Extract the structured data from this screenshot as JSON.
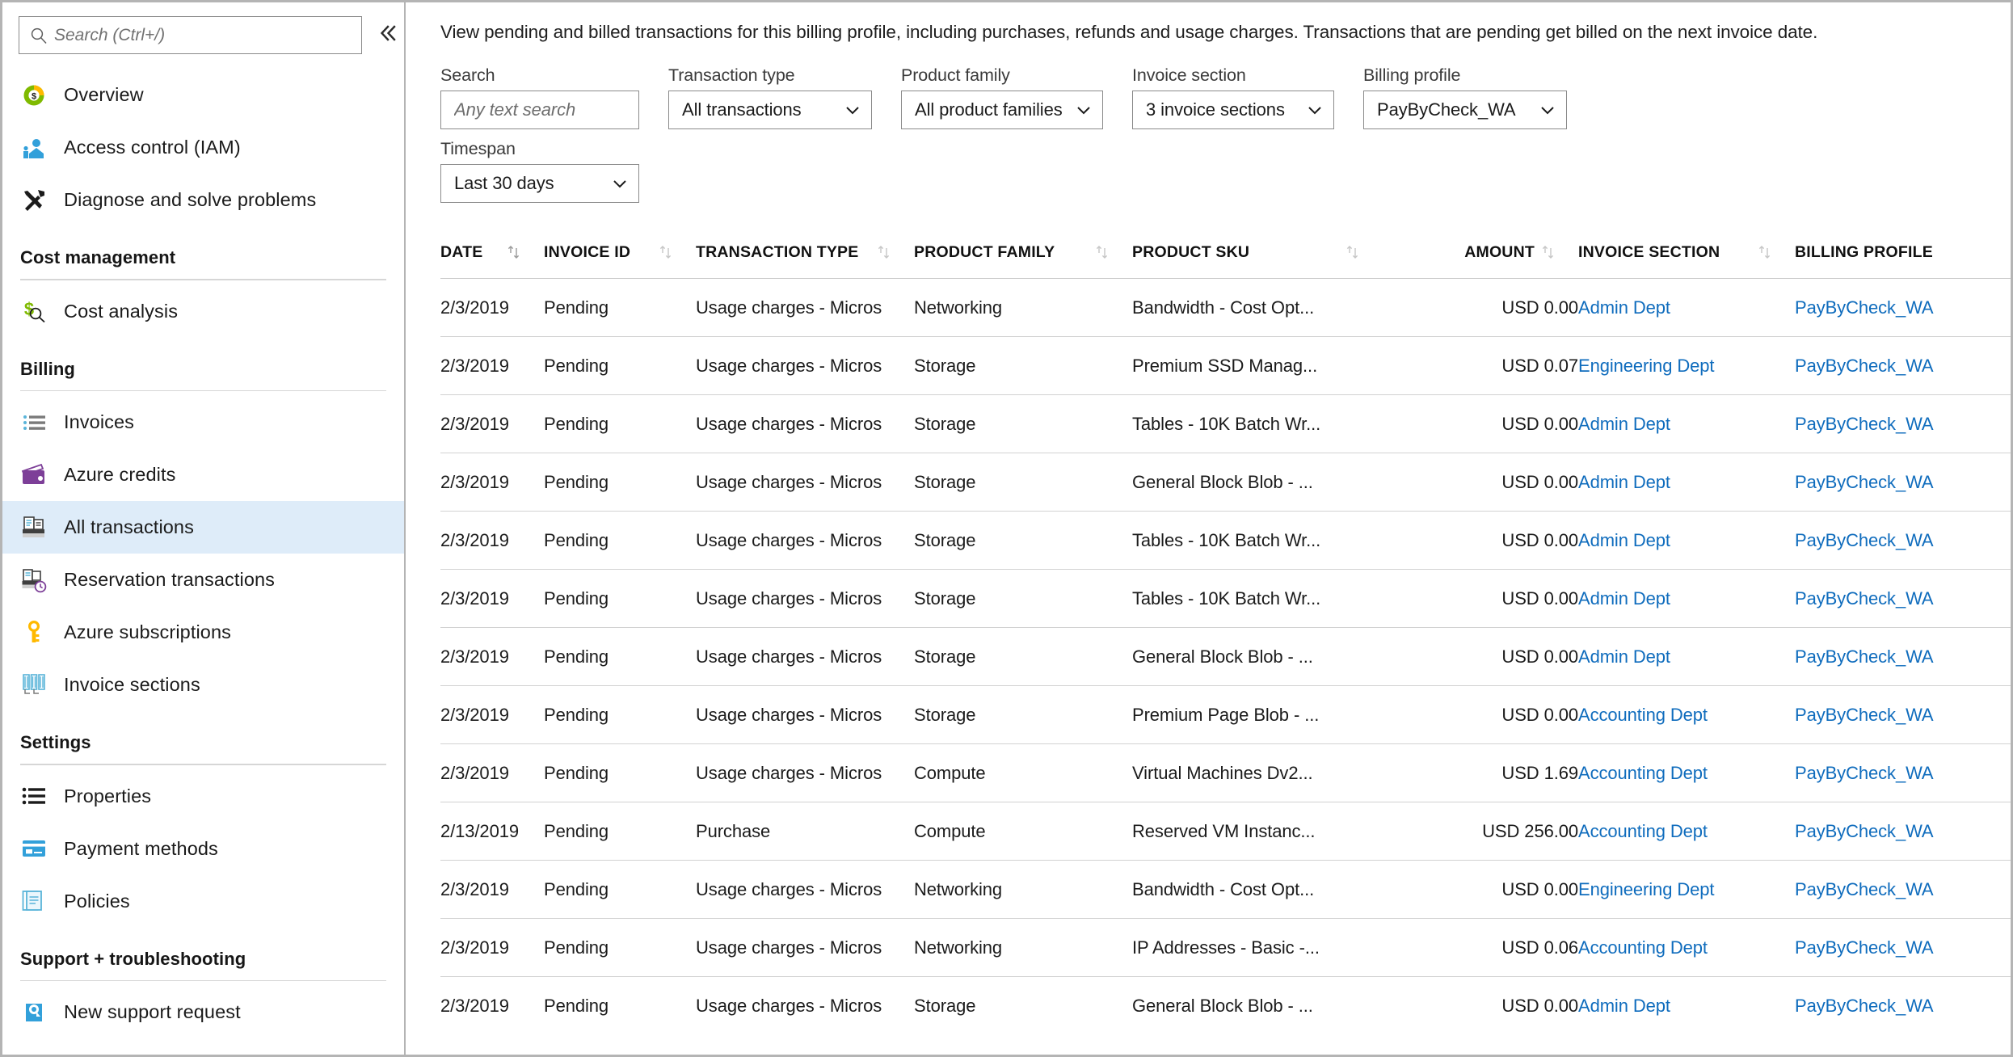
{
  "sidebar": {
    "search": {
      "placeholder": "Search (Ctrl+/)",
      "value": ""
    },
    "collapse_label": "«",
    "top_items": [
      {
        "label": "Overview",
        "icon": "overview-icon"
      },
      {
        "label": "Access control (IAM)",
        "icon": "access-control-icon"
      },
      {
        "label": "Diagnose and solve problems",
        "icon": "diagnose-icon"
      }
    ],
    "groups": [
      {
        "title": "Cost management",
        "items": [
          {
            "label": "Cost analysis",
            "icon": "cost-analysis-icon"
          }
        ]
      },
      {
        "title": "Billing",
        "items": [
          {
            "label": "Invoices",
            "icon": "invoices-icon"
          },
          {
            "label": "Azure credits",
            "icon": "azure-credits-icon"
          },
          {
            "label": "All transactions",
            "icon": "all-transactions-icon",
            "selected": true
          },
          {
            "label": "Reservation transactions",
            "icon": "reservation-transactions-icon"
          },
          {
            "label": "Azure subscriptions",
            "icon": "azure-subscriptions-icon"
          },
          {
            "label": "Invoice sections",
            "icon": "invoice-sections-icon"
          }
        ]
      },
      {
        "title": "Settings",
        "items": [
          {
            "label": "Properties",
            "icon": "properties-icon"
          },
          {
            "label": "Payment methods",
            "icon": "payment-methods-icon"
          },
          {
            "label": "Policies",
            "icon": "policies-icon"
          }
        ]
      },
      {
        "title": "Support + troubleshooting",
        "items": [
          {
            "label": "New support request",
            "icon": "support-request-icon"
          }
        ]
      }
    ]
  },
  "main": {
    "description": "View pending and billed transactions for this billing profile, including purchases, refunds and usage charges. Transactions that are pending get billed on the next invoice date.",
    "filters": [
      {
        "label": "Search",
        "type": "text",
        "value": "",
        "placeholder": "Any text search",
        "name": "search"
      },
      {
        "label": "Transaction type",
        "type": "select",
        "value": "All transactions",
        "name": "transaction-type"
      },
      {
        "label": "Product family",
        "type": "select",
        "value": "All product families",
        "name": "product-family"
      },
      {
        "label": "Invoice section",
        "type": "select",
        "value": "3 invoice sections",
        "name": "invoice-section"
      },
      {
        "label": "Billing profile",
        "type": "select",
        "value": "PayByCheck_WA",
        "name": "billing-profile"
      },
      {
        "label": "Timespan",
        "type": "select",
        "value": "Last 30 days",
        "name": "timespan"
      }
    ],
    "table": {
      "columns": [
        {
          "label": "DATE",
          "key": "date",
          "align": "left"
        },
        {
          "label": "INVOICE ID",
          "key": "invoice_id",
          "align": "left"
        },
        {
          "label": "TRANSACTION TYPE",
          "key": "transaction_type",
          "align": "left"
        },
        {
          "label": "PRODUCT FAMILY",
          "key": "product_family",
          "align": "left"
        },
        {
          "label": "PRODUCT SKU",
          "key": "product_sku",
          "align": "left"
        },
        {
          "label": "AMOUNT",
          "key": "amount",
          "align": "right"
        },
        {
          "label": "INVOICE SECTION",
          "key": "invoice_section",
          "align": "left"
        },
        {
          "label": "BILLING PROFILE",
          "key": "billing_profile",
          "align": "left"
        }
      ],
      "rows": [
        {
          "date": "2/3/2019",
          "invoice_id": "Pending",
          "transaction_type": "Usage charges - Micros",
          "product_family": "Networking",
          "product_sku": "Bandwidth - Cost Opt...",
          "amount": "USD 0.00",
          "invoice_section": "Admin Dept",
          "billing_profile": "PayByCheck_WA"
        },
        {
          "date": "2/3/2019",
          "invoice_id": "Pending",
          "transaction_type": "Usage charges - Micros",
          "product_family": "Storage",
          "product_sku": "Premium SSD Manag...",
          "amount": "USD 0.07",
          "invoice_section": "Engineering Dept",
          "billing_profile": "PayByCheck_WA"
        },
        {
          "date": "2/3/2019",
          "invoice_id": "Pending",
          "transaction_type": "Usage charges - Micros",
          "product_family": "Storage",
          "product_sku": "Tables - 10K Batch Wr...",
          "amount": "USD 0.00",
          "invoice_section": "Admin Dept",
          "billing_profile": "PayByCheck_WA"
        },
        {
          "date": "2/3/2019",
          "invoice_id": "Pending",
          "transaction_type": "Usage charges - Micros",
          "product_family": "Storage",
          "product_sku": "General Block Blob - ...",
          "amount": "USD 0.00",
          "invoice_section": "Admin Dept",
          "billing_profile": "PayByCheck_WA"
        },
        {
          "date": "2/3/2019",
          "invoice_id": "Pending",
          "transaction_type": "Usage charges - Micros",
          "product_family": "Storage",
          "product_sku": "Tables - 10K Batch Wr...",
          "amount": "USD 0.00",
          "invoice_section": "Admin Dept",
          "billing_profile": "PayByCheck_WA"
        },
        {
          "date": "2/3/2019",
          "invoice_id": "Pending",
          "transaction_type": "Usage charges - Micros",
          "product_family": "Storage",
          "product_sku": "Tables - 10K Batch Wr...",
          "amount": "USD 0.00",
          "invoice_section": "Admin Dept",
          "billing_profile": "PayByCheck_WA"
        },
        {
          "date": "2/3/2019",
          "invoice_id": "Pending",
          "transaction_type": "Usage charges - Micros",
          "product_family": "Storage",
          "product_sku": "General Block Blob - ...",
          "amount": "USD 0.00",
          "invoice_section": "Admin Dept",
          "billing_profile": "PayByCheck_WA"
        },
        {
          "date": "2/3/2019",
          "invoice_id": "Pending",
          "transaction_type": "Usage charges - Micros",
          "product_family": "Storage",
          "product_sku": "Premium Page Blob - ...",
          "amount": "USD 0.00",
          "invoice_section": "Accounting Dept",
          "billing_profile": "PayByCheck_WA"
        },
        {
          "date": "2/3/2019",
          "invoice_id": "Pending",
          "transaction_type": "Usage charges - Micros",
          "product_family": "Compute",
          "product_sku": "Virtual Machines Dv2...",
          "amount": "USD 1.69",
          "invoice_section": "Accounting Dept",
          "billing_profile": "PayByCheck_WA"
        },
        {
          "date": "2/13/2019",
          "invoice_id": "Pending",
          "transaction_type": "Purchase",
          "product_family": "Compute",
          "product_sku": "Reserved VM Instanc...",
          "amount": "USD 256.00",
          "invoice_section": "Accounting Dept",
          "billing_profile": "PayByCheck_WA"
        },
        {
          "date": "2/3/2019",
          "invoice_id": "Pending",
          "transaction_type": "Usage charges - Micros",
          "product_family": "Networking",
          "product_sku": "Bandwidth - Cost Opt...",
          "amount": "USD 0.00",
          "invoice_section": "Engineering Dept",
          "billing_profile": "PayByCheck_WA"
        },
        {
          "date": "2/3/2019",
          "invoice_id": "Pending",
          "transaction_type": "Usage charges - Micros",
          "product_family": "Networking",
          "product_sku": "IP Addresses - Basic -...",
          "amount": "USD 0.06",
          "invoice_section": "Accounting Dept",
          "billing_profile": "PayByCheck_WA"
        },
        {
          "date": "2/3/2019",
          "invoice_id": "Pending",
          "transaction_type": "Usage charges - Micros",
          "product_family": "Storage",
          "product_sku": "General Block Blob - ...",
          "amount": "USD 0.00",
          "invoice_section": "Admin Dept",
          "billing_profile": "PayByCheck_WA"
        }
      ]
    }
  },
  "colors": {
    "link": "#0f6cbd",
    "selected_row": "#deecf9",
    "muted_text": "#949494",
    "border": "#d2d2d2"
  }
}
